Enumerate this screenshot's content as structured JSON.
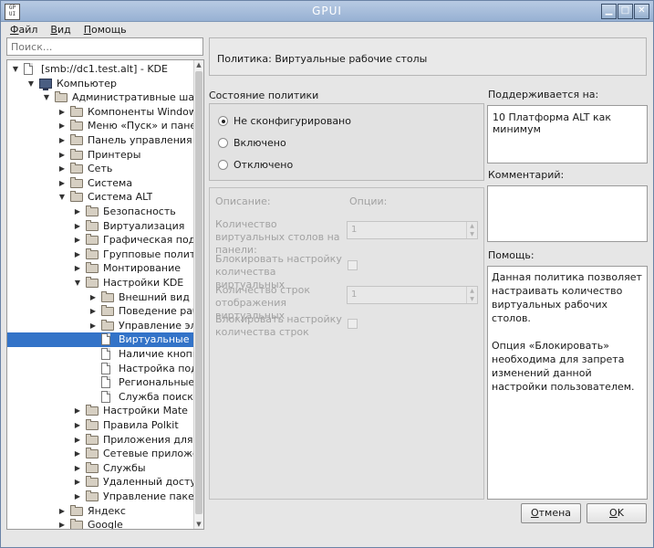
{
  "window": {
    "title": "GPUI",
    "icon_text": "GP UI"
  },
  "menu": [
    {
      "label": "Файл",
      "mnemonic": "Ф",
      "rest": "айл"
    },
    {
      "label": "Вид",
      "mnemonic": "В",
      "rest": "ид"
    },
    {
      "label": "Помощь",
      "mnemonic": "П",
      "rest": "омощь"
    }
  ],
  "search": {
    "placeholder": "Поиск..."
  },
  "tree": [
    {
      "label": "[smb://dc1.test.alt] - KDE",
      "depth": 0,
      "expanded": true,
      "icon": "doc-icon",
      "selected": false
    },
    {
      "label": "Компьютер",
      "depth": 1,
      "expanded": true,
      "icon": "computer-icon",
      "selected": false
    },
    {
      "label": "Административные шаб...",
      "depth": 2,
      "expanded": true,
      "icon": "folder-icon",
      "selected": false
    },
    {
      "label": "Компоненты Windows",
      "depth": 3,
      "expanded": false,
      "icon": "folder-icon",
      "selected": false
    },
    {
      "label": "Меню «Пуск» и панел...",
      "depth": 3,
      "expanded": false,
      "icon": "folder-icon",
      "selected": false
    },
    {
      "label": "Панель управления",
      "depth": 3,
      "expanded": false,
      "icon": "folder-icon",
      "selected": false
    },
    {
      "label": "Принтеры",
      "depth": 3,
      "expanded": false,
      "icon": "folder-icon",
      "selected": false
    },
    {
      "label": "Сеть",
      "depth": 3,
      "expanded": false,
      "icon": "folder-icon",
      "selected": false
    },
    {
      "label": "Система",
      "depth": 3,
      "expanded": false,
      "icon": "folder-icon",
      "selected": false
    },
    {
      "label": "Система ALT",
      "depth": 3,
      "expanded": true,
      "icon": "folder-icon",
      "selected": false
    },
    {
      "label": "Безопасность",
      "depth": 4,
      "expanded": false,
      "icon": "folder-icon",
      "selected": false
    },
    {
      "label": "Виртуализация",
      "depth": 4,
      "expanded": false,
      "icon": "folder-icon",
      "selected": false
    },
    {
      "label": "Графическая подс...",
      "depth": 4,
      "expanded": false,
      "icon": "folder-icon",
      "selected": false
    },
    {
      "label": "Групповые полити...",
      "depth": 4,
      "expanded": false,
      "icon": "folder-icon",
      "selected": false
    },
    {
      "label": "Монтирование",
      "depth": 4,
      "expanded": false,
      "icon": "folder-icon",
      "selected": false
    },
    {
      "label": "Настройки KDE",
      "depth": 4,
      "expanded": true,
      "icon": "folder-icon",
      "selected": false
    },
    {
      "label": "Внешний вид",
      "depth": 5,
      "expanded": false,
      "icon": "folder-icon",
      "selected": false
    },
    {
      "label": "Поведение раб...",
      "depth": 5,
      "expanded": false,
      "icon": "folder-icon",
      "selected": false
    },
    {
      "label": "Управление эл...",
      "depth": 5,
      "expanded": false,
      "icon": "folder-icon",
      "selected": false
    },
    {
      "label": "Виртуальные р...",
      "depth": 5,
      "leaf": true,
      "icon": "doc-icon",
      "selected": true
    },
    {
      "label": "Наличие кнопк...",
      "depth": 5,
      "leaf": true,
      "icon": "doc-icon",
      "selected": false
    },
    {
      "label": "Настройка под...",
      "depth": 5,
      "leaf": true,
      "icon": "doc-icon",
      "selected": false
    },
    {
      "label": "Региональные ...",
      "depth": 5,
      "leaf": true,
      "icon": "doc-icon",
      "selected": false
    },
    {
      "label": "Служба поиска ...",
      "depth": 5,
      "leaf": true,
      "icon": "doc-icon",
      "selected": false
    },
    {
      "label": "Настройки Mate",
      "depth": 4,
      "expanded": false,
      "icon": "folder-icon",
      "selected": false
    },
    {
      "label": "Правила Polkit",
      "depth": 4,
      "expanded": false,
      "icon": "folder-icon",
      "selected": false
    },
    {
      "label": "Приложения для ...",
      "depth": 4,
      "expanded": false,
      "icon": "folder-icon",
      "selected": false
    },
    {
      "label": "Сетевые приложе...",
      "depth": 4,
      "expanded": false,
      "icon": "folder-icon",
      "selected": false
    },
    {
      "label": "Службы",
      "depth": 4,
      "expanded": false,
      "icon": "folder-icon",
      "selected": false
    },
    {
      "label": "Удаленный доступ...",
      "depth": 4,
      "expanded": false,
      "icon": "folder-icon",
      "selected": false
    },
    {
      "label": "Управление пакет...",
      "depth": 4,
      "expanded": false,
      "icon": "folder-icon",
      "selected": false
    },
    {
      "label": "Яндекс",
      "depth": 3,
      "expanded": false,
      "icon": "folder-icon",
      "selected": false
    },
    {
      "label": "Google",
      "depth": 3,
      "expanded": false,
      "icon": "folder-icon",
      "selected": false
    }
  ],
  "policy": {
    "title": "Политика: Виртуальные рабочие столы",
    "state_label": "Состояние политики",
    "states": [
      {
        "label": "Не сконфигурировано",
        "checked": true
      },
      {
        "label": "Включено",
        "checked": false
      },
      {
        "label": "Отключено",
        "checked": false
      }
    ],
    "description_label": "Описание:",
    "options_label": "Опции:",
    "options": [
      {
        "label": "Количество виртуальных столов на панели:",
        "type": "spin",
        "value": "1"
      },
      {
        "label": "Блокировать настройку количества виртуальных",
        "type": "check"
      },
      {
        "label": "Количество строк отображения виртуальных",
        "type": "spin",
        "value": "1"
      },
      {
        "label": "Блокировать настройку количества строк",
        "type": "check"
      }
    ],
    "supported_label": "Поддерживается на:",
    "supported_value": "10 Платформа ALT как минимум",
    "comment_label": "Комментарий:",
    "comment_value": "",
    "help_label": "Помощь:",
    "help_paragraphs": [
      "Данная политика позволяет настраивать количество виртуальных рабочих столов.",
      "Опция «Блокировать» необходима для запрета изменений данной настройки пользователем."
    ]
  },
  "buttons": {
    "cancel": {
      "label": "Отмена",
      "mnemonic": "О",
      "rest": "тмена"
    },
    "ok": {
      "label": "OK",
      "mnemonic": "O",
      "rest": "K"
    }
  },
  "colors": {
    "selection": "#3373c8",
    "titlebar": "#a8bedb"
  }
}
